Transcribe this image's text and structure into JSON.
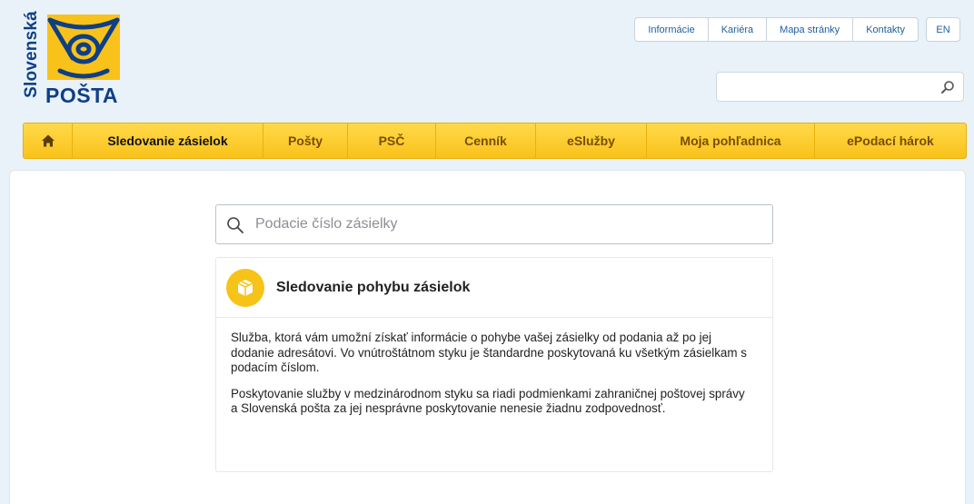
{
  "logo": {
    "vertical_text": "Slovenská",
    "brand_text": "POŠTA",
    "icon": "posthorn-icon",
    "colors": {
      "blue": "#0e3f86",
      "yellow": "#f9c21a"
    }
  },
  "top_links": [
    {
      "label": "Informácie"
    },
    {
      "label": "Kariéra"
    },
    {
      "label": "Mapa stránky"
    },
    {
      "label": "Kontakty"
    }
  ],
  "language": {
    "label": "EN"
  },
  "top_search": {
    "value": "",
    "placeholder": "",
    "icon": "search-icon"
  },
  "nav": {
    "home_icon": "home-icon",
    "items": [
      {
        "label": "Sledovanie zásielok",
        "active": true
      },
      {
        "label": "Pošty"
      },
      {
        "label": "PSČ"
      },
      {
        "label": "Cenník"
      },
      {
        "label": "eSlužby"
      },
      {
        "label": "Moja pohľadnica"
      },
      {
        "label": "ePodací hárok"
      }
    ]
  },
  "tracking_search": {
    "placeholder": "Podacie číslo zásielky",
    "value": "",
    "icon": "search-icon"
  },
  "info_box": {
    "icon": "package-icon",
    "title": "Sledovanie pohybu zásielok",
    "paragraphs": [
      "Služba, ktorá vám umožní získať informácie o pohybe vašej zásielky od podania až po jej dodanie adresátovi. Vo vnútroštátnom styku je štandardne poskytovaná ku všetkým zásielkam s podacím číslom.",
      "Poskytovanie služby v medzinárodnom styku sa riadi podmienkami zahraničnej poštovej správy a Slovenská pošta za jej nesprávne poskytovanie nenesie žiadnu zodpovednosť."
    ]
  }
}
